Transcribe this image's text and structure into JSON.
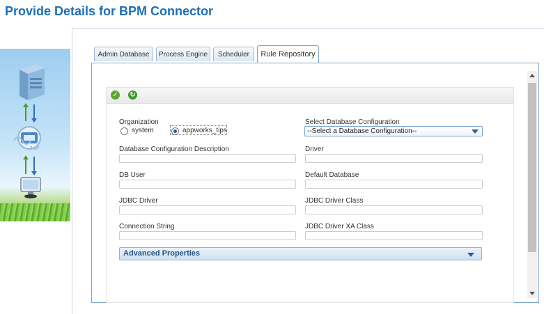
{
  "page": {
    "title": "Provide Details for BPM Connector"
  },
  "tabs": [
    {
      "label": "Admin Database",
      "active": false
    },
    {
      "label": "Process Engine",
      "active": false
    },
    {
      "label": "Scheduler",
      "active": false
    },
    {
      "label": "Rule Repository",
      "active": true
    }
  ],
  "toolbar": {
    "save_icon": "check-icon",
    "refresh_icon": "refresh-icon"
  },
  "form": {
    "organization_label": "Organization",
    "org_options": [
      {
        "label": "system",
        "selected": false
      },
      {
        "label": "appworks_tips",
        "selected": true
      }
    ],
    "select_db_config_label": "Select Database Configuration",
    "select_db_config_value": "--Select a Database Configuration--",
    "db_config_desc_label": "Database Configuration Description",
    "db_config_desc_value": "",
    "driver_label": "Driver",
    "driver_value": "",
    "db_user_label": "DB User",
    "db_user_value": "",
    "default_db_label": "Default Database",
    "default_db_value": "",
    "jdbc_driver_label": "JDBC Driver",
    "jdbc_driver_value": "",
    "jdbc_driver_class_label": "JDBC Driver Class",
    "jdbc_driver_class_value": "",
    "connection_string_label": "Connection String",
    "connection_string_value": "",
    "jdbc_driver_xa_label": "JDBC Driver XA Class",
    "jdbc_driver_xa_value": "",
    "advanced_label": "Advanced Properties"
  },
  "colors": {
    "title": "#1f6fb5",
    "tab_border": "#7fa6cc",
    "check_green": "#5aa832",
    "refresh_green": "#3c9a2a"
  }
}
